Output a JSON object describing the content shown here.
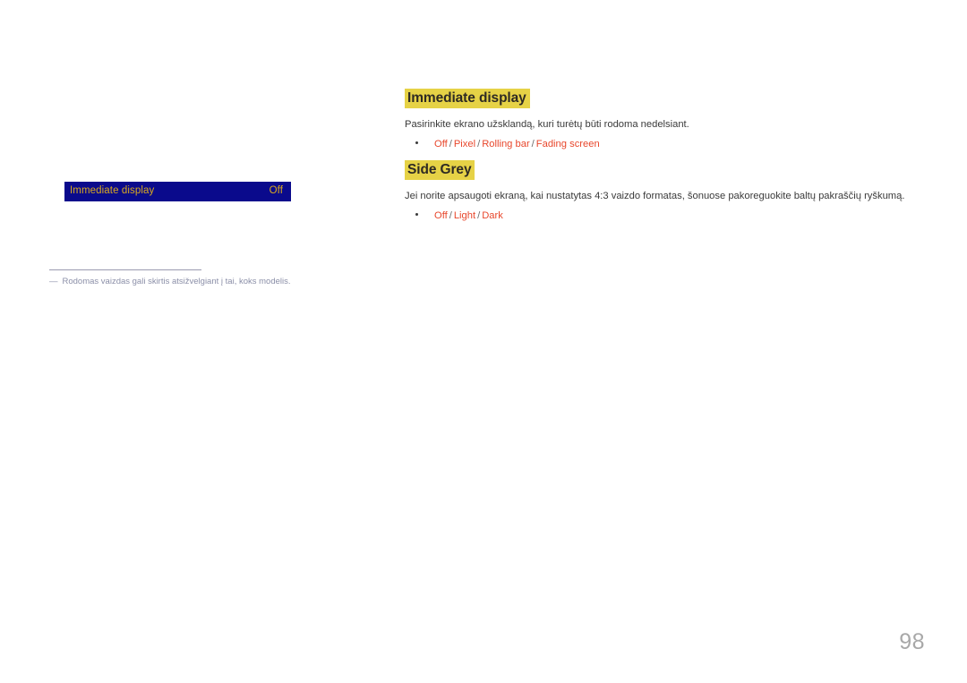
{
  "page": {
    "number": "98",
    "background_color": "#ffffff"
  },
  "osd_preview": {
    "row": {
      "label": "Immediate display",
      "value": "Off",
      "background_color": "#0a0a8c",
      "text_color": "#d8a820"
    }
  },
  "footnote": {
    "dash": "―",
    "text": "Rodomas vaizdas gali skirtis atsižvelgiant į tai, koks modelis.",
    "text_color": "#8b8fa8"
  },
  "sections": [
    {
      "heading": "Immediate display",
      "heading_highlight_color": "#e6d246",
      "body": "Pasirinkite ekrano užsklandą, kuri turėtų būti rodoma nedelsiant.",
      "options": [
        "Off",
        "Pixel",
        "Rolling bar",
        "Fading screen"
      ],
      "option_separator": "/",
      "option_color": "#e8472c"
    },
    {
      "heading": "Side Grey",
      "heading_highlight_color": "#e6d246",
      "body": "Jei norite apsaugoti ekraną, kai nustatytas 4:3 vaizdo formatas, šonuose pakoreguokite baltų pakraščių ryškumą.",
      "options": [
        "Off",
        "Light",
        "Dark"
      ],
      "option_separator": "/",
      "option_color": "#e8472c"
    }
  ]
}
